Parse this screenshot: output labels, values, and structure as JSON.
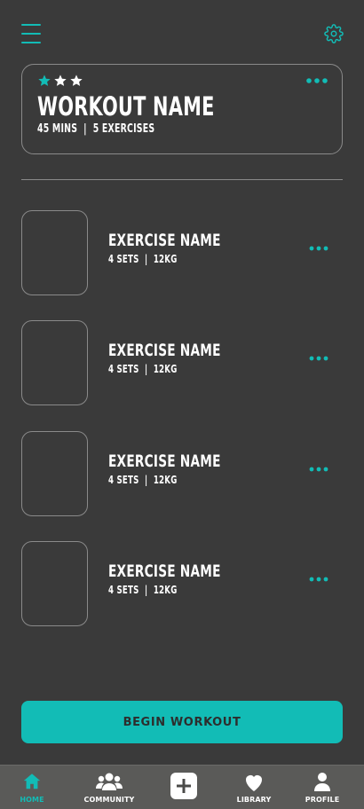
{
  "colors": {
    "accent": "#12bcb6",
    "background": "#3a3a3a",
    "nav_background": "#5a5a58",
    "border": "#8a8a8a"
  },
  "header": {
    "menu_icon": "hamburger-menu-icon",
    "settings_icon": "gear-icon"
  },
  "workout": {
    "rating": 3,
    "rating_filled": 1,
    "title": "WORKOUT NAME",
    "duration": "45 MINS",
    "exercise_count": "5 EXERCISES",
    "more_icon": "more-dots-icon"
  },
  "exercises": [
    {
      "name": "EXERCISE NAME",
      "sets": "4 SETS",
      "weight": "12KG"
    },
    {
      "name": "EXERCISE NAME",
      "sets": "4 SETS",
      "weight": "12KG"
    },
    {
      "name": "EXERCISE NAME",
      "sets": "4 SETS",
      "weight": "12KG"
    },
    {
      "name": "EXERCISE NAME",
      "sets": "4 SETS",
      "weight": "12KG"
    }
  ],
  "actions": {
    "begin_label": "BEGIN WORKOUT"
  },
  "nav": {
    "items": [
      {
        "label": "HOME",
        "icon": "home-icon",
        "active": true
      },
      {
        "label": "COMMUNITY",
        "icon": "community-icon",
        "active": false
      },
      {
        "label": "",
        "icon": "add-icon",
        "active": false
      },
      {
        "label": "LIBRARY",
        "icon": "heart-icon",
        "active": false
      },
      {
        "label": "PROFILE",
        "icon": "profile-icon",
        "active": false
      }
    ]
  }
}
